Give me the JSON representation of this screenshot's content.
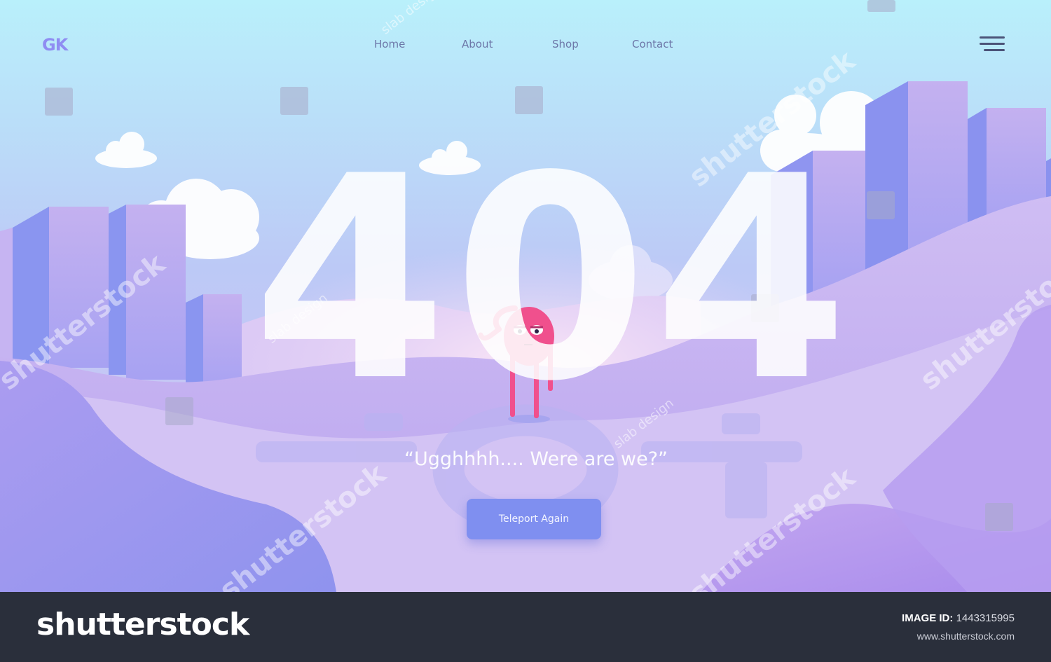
{
  "header": {
    "logo": "GK",
    "nav": [
      "Home",
      "About",
      "Shop",
      "Contact"
    ]
  },
  "hero": {
    "code": "404",
    "message": "“Ugghhhh.... Were are we?”",
    "button_label": "Teleport Again"
  },
  "watermark": {
    "brand": "shutterstock",
    "credit": "slab design"
  },
  "footer": {
    "brand": "shutterstock",
    "image_id_label": "IMAGE ID:",
    "image_id": "1443315995",
    "site": "www.shutterstock.com"
  },
  "colors": {
    "sky_top": "#b9f0fb",
    "sky_bottom": "#c9b8f2",
    "building": "#a59cf0",
    "hill": "#c6b6f1",
    "character": "#f0508d",
    "button": "#7f8ff0",
    "footer": "#2a2f3b"
  },
  "icons": [
    "hamburger-menu-icon",
    "monster-character"
  ]
}
